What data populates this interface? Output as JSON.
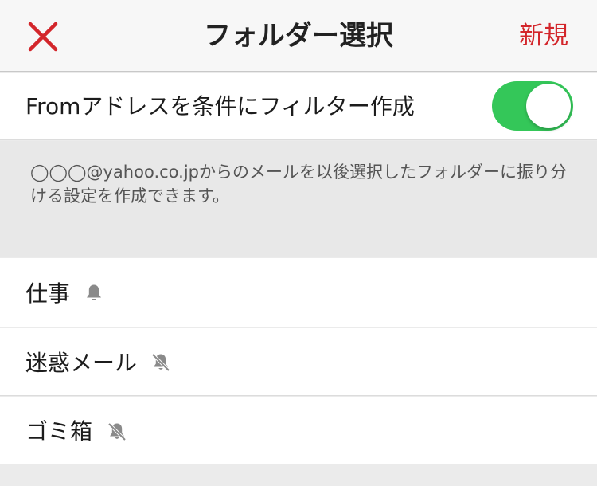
{
  "header": {
    "close_icon": "close-icon",
    "title": "フォルダー選択",
    "new_label": "新規",
    "accent_color": "#d3262b"
  },
  "filter_toggle": {
    "label": "Fromアドレスを条件にフィルター作成",
    "state": "on",
    "on_color": "#34c759"
  },
  "description": {
    "text": "◯◯◯@yahoo.co.jpからのメールを以後選択したフォルダーに振り分ける設定を作成できます。"
  },
  "folders": [
    {
      "name": "仕事",
      "notification": "on",
      "icon": "bell-icon"
    },
    {
      "name": "迷惑メール",
      "notification": "off",
      "icon": "bell-slash-icon"
    },
    {
      "name": "ゴミ箱",
      "notification": "off",
      "icon": "bell-slash-icon"
    }
  ]
}
